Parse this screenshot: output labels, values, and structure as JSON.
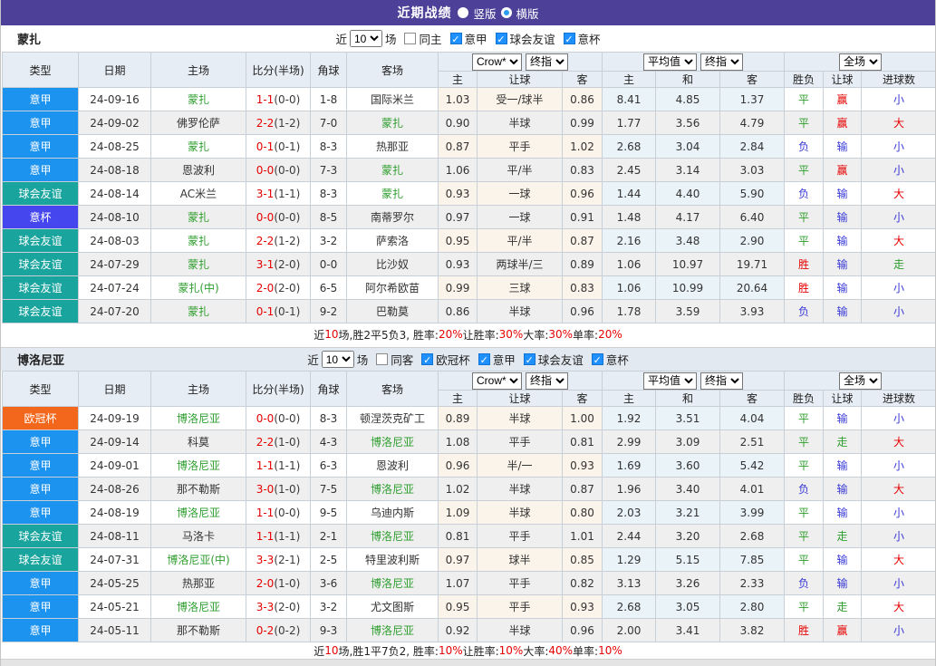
{
  "title_bar": {
    "title": "近期战绩",
    "radio_vertical": "竖版",
    "radio_horizontal": "横版"
  },
  "type_colors": {
    "意甲": "#1d93f0",
    "球会友谊": "#19a49e",
    "意杯": "#4646ef",
    "欧冠杯": "#f2671c"
  },
  "header": {
    "cols": [
      "类型",
      "日期",
      "主场",
      "比分(半场)",
      "角球",
      "客场"
    ],
    "crow_select": "Crow*",
    "final_select": "终指",
    "avg_select": "平均值",
    "final2_select": "终指",
    "full_select": "全场",
    "sub_crow": [
      "主",
      "让球",
      "客"
    ],
    "sub_avg": [
      "主",
      "和",
      "客"
    ],
    "sub_result": [
      "胜负",
      "让球",
      "进球数"
    ]
  },
  "sections": [
    {
      "team": "蒙扎",
      "filter": {
        "prefix": "近",
        "count": "10",
        "suffix": "场",
        "same_label": "同主",
        "same_checked": false,
        "leagues": [
          {
            "label": "意甲",
            "checked": true
          },
          {
            "label": "球会友谊",
            "checked": true
          },
          {
            "label": "意杯",
            "checked": true
          }
        ]
      },
      "rows": [
        {
          "type": "意甲",
          "date": "24-09-16",
          "home": "蒙扎",
          "hg": 1,
          "score": "1-1",
          "half": "(0-0)",
          "corner": "1-8",
          "away": "国际米兰",
          "ag": 0,
          "crow": [
            "1.03",
            "受一/球半",
            "0.86"
          ],
          "avg": [
            "8.41",
            "4.85",
            "1.37"
          ],
          "res": [
            [
              "平",
              "green"
            ],
            [
              "赢",
              "red"
            ],
            [
              "小",
              "blue"
            ]
          ]
        },
        {
          "type": "意甲",
          "date": "24-09-02",
          "home": "佛罗伦萨",
          "hg": 0,
          "score": "2-2",
          "half": "(1-2)",
          "corner": "7-0",
          "away": "蒙扎",
          "ag": 1,
          "crow": [
            "0.90",
            "半球",
            "0.99"
          ],
          "avg": [
            "1.77",
            "3.56",
            "4.79"
          ],
          "res": [
            [
              "平",
              "green"
            ],
            [
              "赢",
              "red"
            ],
            [
              "大",
              "red"
            ]
          ]
        },
        {
          "type": "意甲",
          "date": "24-08-25",
          "home": "蒙扎",
          "hg": 1,
          "score": "0-1",
          "half": "(0-1)",
          "corner": "8-3",
          "away": "热那亚",
          "ag": 0,
          "crow": [
            "0.87",
            "平手",
            "1.02"
          ],
          "avg": [
            "2.68",
            "3.04",
            "2.84"
          ],
          "res": [
            [
              "负",
              "blue"
            ],
            [
              "输",
              "blue"
            ],
            [
              "小",
              "blue"
            ]
          ]
        },
        {
          "type": "意甲",
          "date": "24-08-18",
          "home": "恩波利",
          "hg": 0,
          "score": "0-0",
          "half": "(0-0)",
          "corner": "7-3",
          "away": "蒙扎",
          "ag": 1,
          "crow": [
            "1.06",
            "平/半",
            "0.83"
          ],
          "avg": [
            "2.45",
            "3.14",
            "3.03"
          ],
          "res": [
            [
              "平",
              "green"
            ],
            [
              "赢",
              "red"
            ],
            [
              "小",
              "blue"
            ]
          ]
        },
        {
          "type": "球会友谊",
          "date": "24-08-14",
          "home": "AC米兰",
          "hg": 0,
          "score": "3-1",
          "half": "(1-1)",
          "corner": "8-3",
          "away": "蒙扎",
          "ag": 1,
          "crow": [
            "0.93",
            "一球",
            "0.96"
          ],
          "avg": [
            "1.44",
            "4.40",
            "5.90"
          ],
          "res": [
            [
              "负",
              "blue"
            ],
            [
              "输",
              "blue"
            ],
            [
              "大",
              "red"
            ]
          ]
        },
        {
          "type": "意杯",
          "date": "24-08-10",
          "home": "蒙扎",
          "hg": 1,
          "score": "0-0",
          "half": "(0-0)",
          "corner": "8-5",
          "away": "南蒂罗尔",
          "ag": 0,
          "crow": [
            "0.97",
            "一球",
            "0.91"
          ],
          "avg": [
            "1.48",
            "4.17",
            "6.40"
          ],
          "res": [
            [
              "平",
              "green"
            ],
            [
              "输",
              "blue"
            ],
            [
              "小",
              "blue"
            ]
          ]
        },
        {
          "type": "球会友谊",
          "date": "24-08-03",
          "home": "蒙扎",
          "hg": 1,
          "score": "2-2",
          "half": "(1-2)",
          "corner": "3-2",
          "away": "萨索洛",
          "ag": 0,
          "crow": [
            "0.95",
            "平/半",
            "0.87"
          ],
          "avg": [
            "2.16",
            "3.48",
            "2.90"
          ],
          "res": [
            [
              "平",
              "green"
            ],
            [
              "输",
              "blue"
            ],
            [
              "大",
              "red"
            ]
          ]
        },
        {
          "type": "球会友谊",
          "date": "24-07-29",
          "home": "蒙扎",
          "hg": 1,
          "score": "3-1",
          "half": "(2-0)",
          "corner": "0-0",
          "away": "比沙奴",
          "ag": 0,
          "crow": [
            "0.93",
            "两球半/三",
            "0.89"
          ],
          "avg": [
            "1.06",
            "10.97",
            "19.71"
          ],
          "res": [
            [
              "胜",
              "red"
            ],
            [
              "输",
              "blue"
            ],
            [
              "走",
              "green"
            ]
          ]
        },
        {
          "type": "球会友谊",
          "date": "24-07-24",
          "home": "蒙扎(中)",
          "hg": 1,
          "score": "2-0",
          "half": "(2-0)",
          "corner": "6-5",
          "away": "阿尔希欧苗",
          "ag": 0,
          "crow": [
            "0.99",
            "三球",
            "0.83"
          ],
          "avg": [
            "1.06",
            "10.99",
            "20.64"
          ],
          "res": [
            [
              "胜",
              "red"
            ],
            [
              "输",
              "blue"
            ],
            [
              "小",
              "blue"
            ]
          ]
        },
        {
          "type": "球会友谊",
          "date": "24-07-20",
          "home": "蒙扎",
          "hg": 1,
          "score": "0-1",
          "half": "(0-1)",
          "corner": "9-2",
          "away": "巴勒莫",
          "ag": 0,
          "crow": [
            "0.86",
            "半球",
            "0.96"
          ],
          "avg": [
            "1.78",
            "3.59",
            "3.93"
          ],
          "res": [
            [
              "负",
              "blue"
            ],
            [
              "输",
              "blue"
            ],
            [
              "小",
              "blue"
            ]
          ]
        }
      ],
      "summary": [
        [
          "近",
          0
        ],
        [
          "10",
          1
        ],
        [
          "场,胜2平5负3, 胜率:",
          0
        ],
        [
          "20%",
          1
        ],
        [
          " 让胜率:",
          0
        ],
        [
          "30%",
          1
        ],
        [
          " 大率:",
          0
        ],
        [
          "30%",
          1
        ],
        [
          " 单率:",
          0
        ],
        [
          "20%",
          1
        ]
      ]
    },
    {
      "team": "博洛尼亚",
      "filter": {
        "prefix": "近",
        "count": "10",
        "suffix": "场",
        "same_label": "同客",
        "same_checked": false,
        "leagues": [
          {
            "label": "欧冠杯",
            "checked": true
          },
          {
            "label": "意甲",
            "checked": true
          },
          {
            "label": "球会友谊",
            "checked": true
          },
          {
            "label": "意杯",
            "checked": true
          }
        ]
      },
      "rows": [
        {
          "type": "欧冠杯",
          "date": "24-09-19",
          "home": "博洛尼亚",
          "hg": 1,
          "score": "0-0",
          "half": "(0-0)",
          "corner": "8-3",
          "away": "顿涅茨克矿工",
          "ag": 0,
          "crow": [
            "0.89",
            "半球",
            "1.00"
          ],
          "avg": [
            "1.92",
            "3.51",
            "4.04"
          ],
          "res": [
            [
              "平",
              "green"
            ],
            [
              "输",
              "blue"
            ],
            [
              "小",
              "blue"
            ]
          ]
        },
        {
          "type": "意甲",
          "date": "24-09-14",
          "home": "科莫",
          "hg": 0,
          "score": "2-2",
          "half": "(1-0)",
          "corner": "4-3",
          "away": "博洛尼亚",
          "ag": 1,
          "crow": [
            "1.08",
            "平手",
            "0.81"
          ],
          "avg": [
            "2.99",
            "3.09",
            "2.51"
          ],
          "res": [
            [
              "平",
              "green"
            ],
            [
              "走",
              "green"
            ],
            [
              "大",
              "red"
            ]
          ]
        },
        {
          "type": "意甲",
          "date": "24-09-01",
          "home": "博洛尼亚",
          "hg": 1,
          "score": "1-1",
          "half": "(1-1)",
          "corner": "6-3",
          "away": "恩波利",
          "ag": 0,
          "crow": [
            "0.96",
            "半/一",
            "0.93"
          ],
          "avg": [
            "1.69",
            "3.60",
            "5.42"
          ],
          "res": [
            [
              "平",
              "green"
            ],
            [
              "输",
              "blue"
            ],
            [
              "小",
              "blue"
            ]
          ]
        },
        {
          "type": "意甲",
          "date": "24-08-26",
          "home": "那不勒斯",
          "hg": 0,
          "score": "3-0",
          "half": "(1-0)",
          "corner": "7-5",
          "away": "博洛尼亚",
          "ag": 1,
          "crow": [
            "1.02",
            "半球",
            "0.87"
          ],
          "avg": [
            "1.96",
            "3.40",
            "4.01"
          ],
          "res": [
            [
              "负",
              "blue"
            ],
            [
              "输",
              "blue"
            ],
            [
              "大",
              "red"
            ]
          ]
        },
        {
          "type": "意甲",
          "date": "24-08-19",
          "home": "博洛尼亚",
          "hg": 1,
          "score": "1-1",
          "half": "(0-0)",
          "corner": "9-5",
          "away": "乌迪内斯",
          "ag": 0,
          "crow": [
            "1.09",
            "半球",
            "0.80"
          ],
          "avg": [
            "2.03",
            "3.21",
            "3.99"
          ],
          "res": [
            [
              "平",
              "green"
            ],
            [
              "输",
              "blue"
            ],
            [
              "小",
              "blue"
            ]
          ]
        },
        {
          "type": "球会友谊",
          "date": "24-08-11",
          "home": "马洛卡",
          "hg": 0,
          "score": "1-1",
          "half": "(1-1)",
          "corner": "2-1",
          "away": "博洛尼亚",
          "ag": 1,
          "crow": [
            "0.81",
            "平手",
            "1.01"
          ],
          "avg": [
            "2.44",
            "3.20",
            "2.68"
          ],
          "res": [
            [
              "平",
              "green"
            ],
            [
              "走",
              "green"
            ],
            [
              "小",
              "blue"
            ]
          ]
        },
        {
          "type": "球会友谊",
          "date": "24-07-31",
          "home": "博洛尼亚(中)",
          "hg": 1,
          "score": "3-3",
          "half": "(2-1)",
          "corner": "2-5",
          "away": "特里波利斯",
          "ag": 0,
          "crow": [
            "0.97",
            "球半",
            "0.85"
          ],
          "avg": [
            "1.29",
            "5.15",
            "7.85"
          ],
          "res": [
            [
              "平",
              "green"
            ],
            [
              "输",
              "blue"
            ],
            [
              "大",
              "red"
            ]
          ]
        },
        {
          "type": "意甲",
          "date": "24-05-25",
          "home": "热那亚",
          "hg": 0,
          "score": "2-0",
          "half": "(1-0)",
          "corner": "3-6",
          "away": "博洛尼亚",
          "ag": 1,
          "crow": [
            "1.07",
            "平手",
            "0.82"
          ],
          "avg": [
            "3.13",
            "3.26",
            "2.33"
          ],
          "res": [
            [
              "负",
              "blue"
            ],
            [
              "输",
              "blue"
            ],
            [
              "小",
              "blue"
            ]
          ]
        },
        {
          "type": "意甲",
          "date": "24-05-21",
          "home": "博洛尼亚",
          "hg": 1,
          "score": "3-3",
          "half": "(2-0)",
          "corner": "3-2",
          "away": "尤文图斯",
          "ag": 0,
          "crow": [
            "0.95",
            "平手",
            "0.93"
          ],
          "avg": [
            "2.68",
            "3.05",
            "2.80"
          ],
          "res": [
            [
              "平",
              "green"
            ],
            [
              "走",
              "green"
            ],
            [
              "大",
              "red"
            ]
          ]
        },
        {
          "type": "意甲",
          "date": "24-05-11",
          "home": "那不勒斯",
          "hg": 0,
          "score": "0-2",
          "half": "(0-2)",
          "corner": "9-3",
          "away": "博洛尼亚",
          "ag": 1,
          "crow": [
            "0.92",
            "半球",
            "0.96"
          ],
          "avg": [
            "2.00",
            "3.41",
            "3.82"
          ],
          "res": [
            [
              "胜",
              "red"
            ],
            [
              "赢",
              "red"
            ],
            [
              "小",
              "blue"
            ]
          ]
        }
      ],
      "summary": [
        [
          "近",
          0
        ],
        [
          "10",
          1
        ],
        [
          "场,胜1平7负2, 胜率:",
          0
        ],
        [
          "10%",
          1
        ],
        [
          " 让胜率:",
          0
        ],
        [
          "10%",
          1
        ],
        [
          " 大率:",
          0
        ],
        [
          "40%",
          1
        ],
        [
          " 单率:",
          0
        ],
        [
          "10%",
          1
        ]
      ]
    }
  ]
}
